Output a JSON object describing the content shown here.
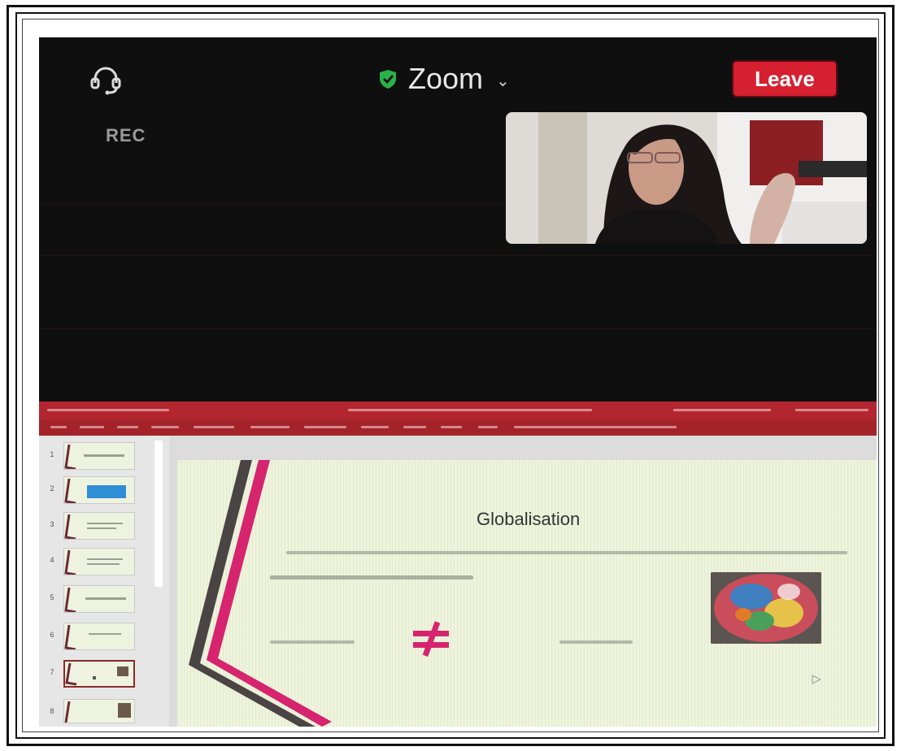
{
  "zoom": {
    "title": "Zoom",
    "rec_label": "REC",
    "leave_label": "Leave",
    "colors": {
      "leave_bg": "#d6202f",
      "shield": "#2ab24a",
      "background": "#0f0f0f"
    },
    "icons": {
      "support": "headset-icon",
      "security": "shield-check-icon",
      "dropdown": "chevron-down-icon"
    }
  },
  "powerpoint": {
    "colors": {
      "ribbon": "#b3262f",
      "slide_bg": "#eef3dc",
      "accent": "#d6246e"
    },
    "slide": {
      "title": "Globalisation"
    },
    "thumbnails": {
      "numbers": [
        "1",
        "2",
        "3",
        "4",
        "5",
        "6",
        "7",
        "8"
      ]
    }
  }
}
